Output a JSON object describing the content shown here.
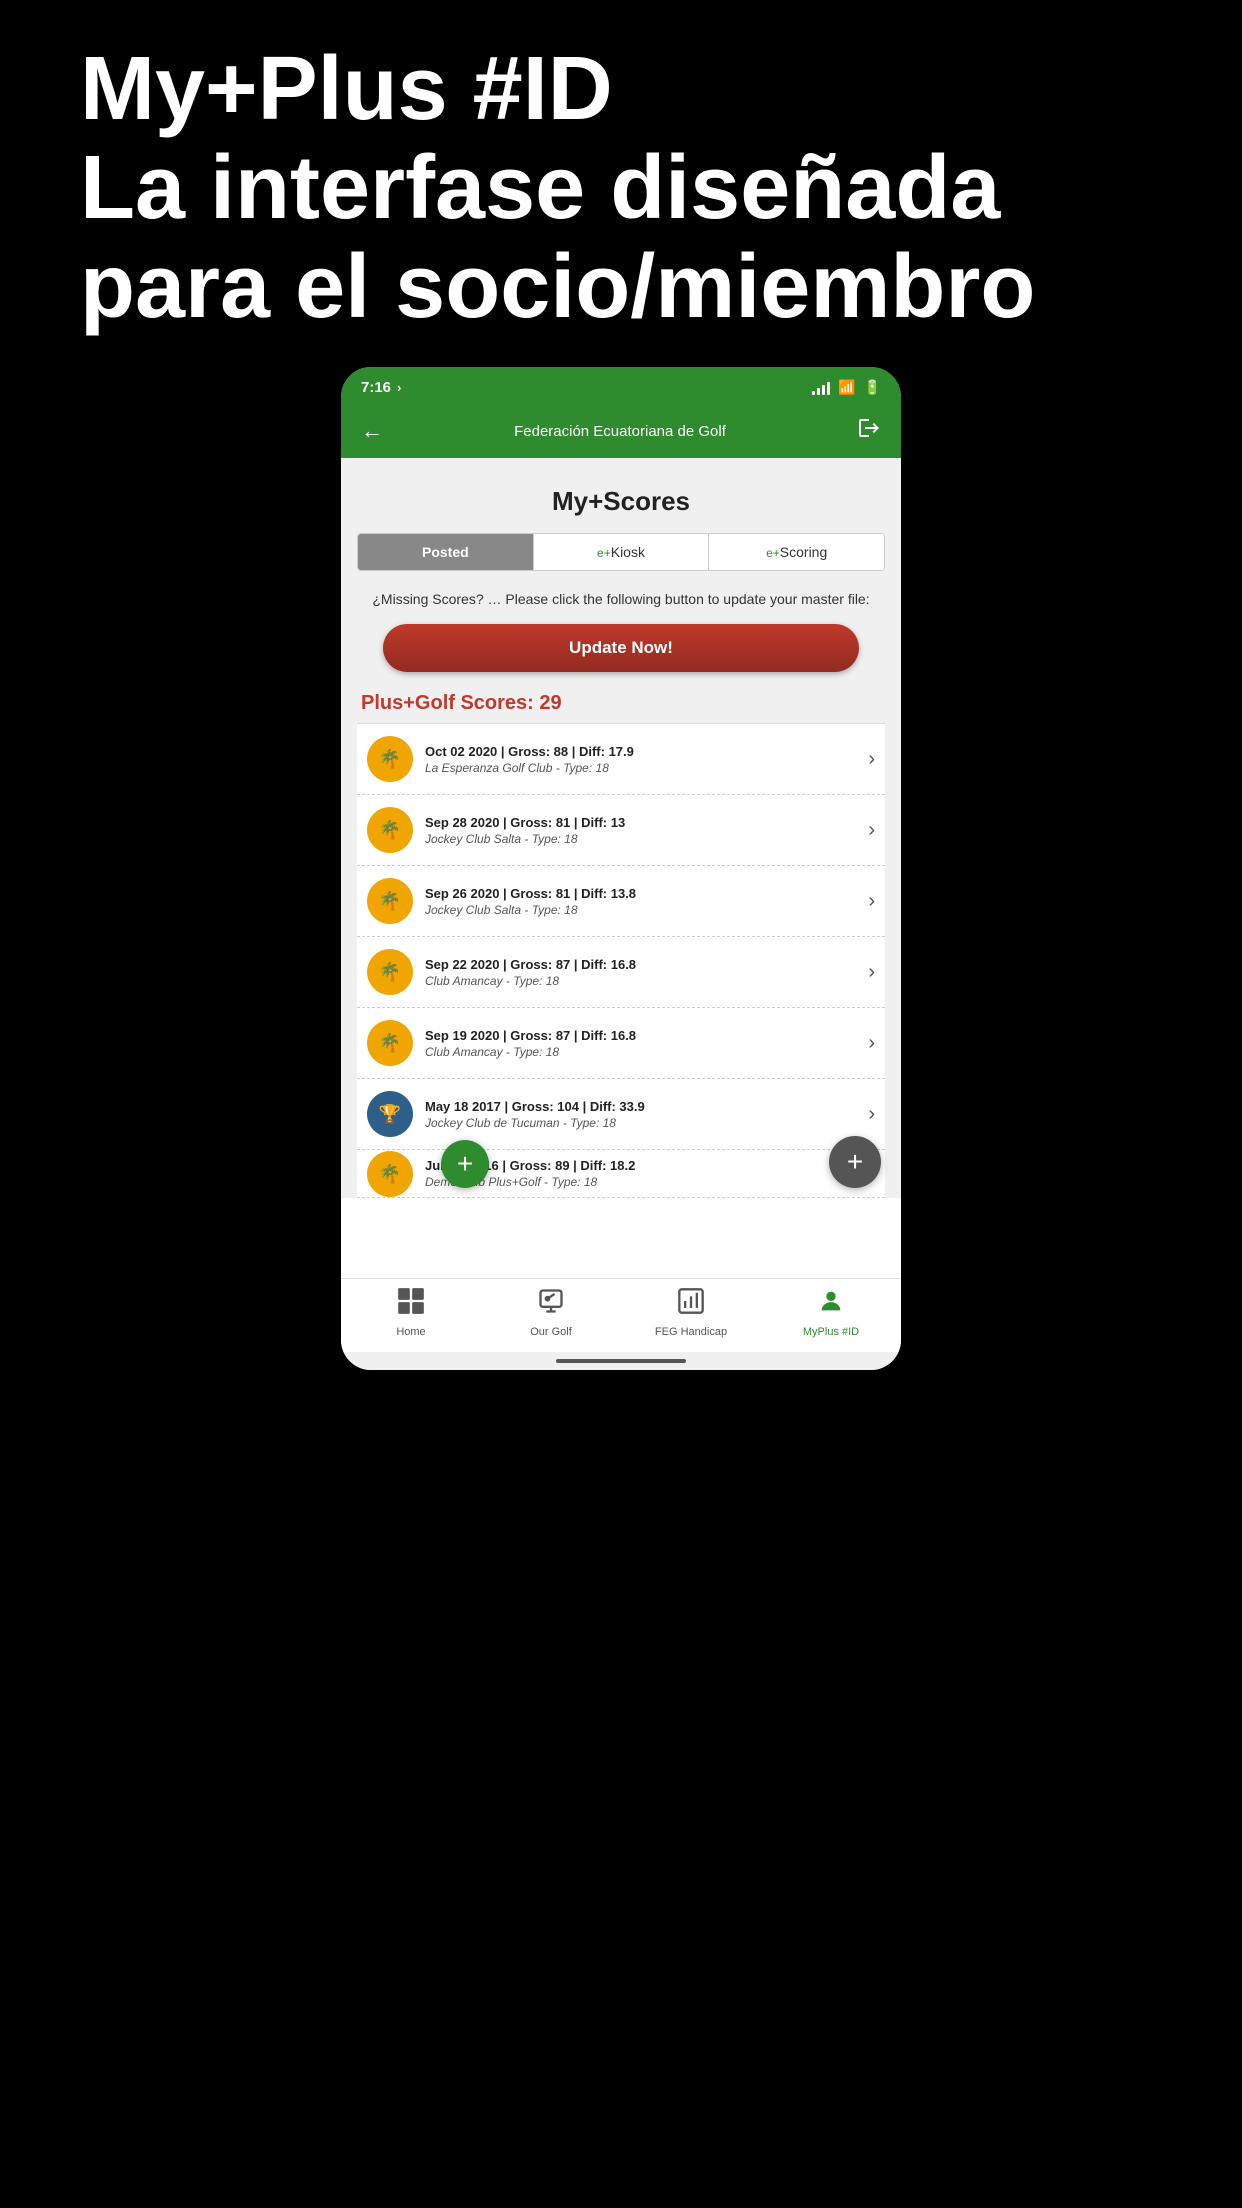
{
  "outer": {
    "title_line1": "My+Plus #ID",
    "title_line2": "La interfase diseñada",
    "title_line3": "para el socio/miembro"
  },
  "status_bar": {
    "time": "7:16",
    "location_icon": "›"
  },
  "nav_bar": {
    "title": "Federación Ecuatoriana de Golf",
    "back_label": "←",
    "logout_label": "⎋"
  },
  "page": {
    "title": "My+Scores"
  },
  "tabs": [
    {
      "label": "Posted",
      "active": true,
      "prefix": ""
    },
    {
      "label": "Kiosk",
      "active": false,
      "prefix": "e+"
    },
    {
      "label": "Scoring",
      "active": false,
      "prefix": "e+"
    }
  ],
  "missing_note": "¿Missing Scores? … Please click the following button to update your master file:",
  "update_button": "Update Now!",
  "scores_heading": "Plus+Golf Scores: 29",
  "scores": [
    {
      "date_gross_diff": "Oct 02 2020 | Gross: 88 | Diff: 17.9",
      "club_type": "La Esperanza Golf Club - Type: 18",
      "icon_type": "palm"
    },
    {
      "date_gross_diff": "Sep 28 2020 | Gross: 81 | Diff: 13",
      "club_type": "Jockey Club Salta - Type: 18",
      "icon_type": "palm"
    },
    {
      "date_gross_diff": "Sep 26 2020 | Gross: 81 | Diff: 13.8",
      "club_type": "Jockey Club Salta - Type: 18",
      "icon_type": "palm"
    },
    {
      "date_gross_diff": "Sep 22 2020 | Gross: 87 | Diff: 16.8",
      "club_type": "Club Amancay - Type: 18",
      "icon_type": "palm"
    },
    {
      "date_gross_diff": "Sep 19 2020 | Gross: 87 | Diff: 16.8",
      "club_type": "Club Amancay - Type: 18",
      "icon_type": "palm"
    },
    {
      "date_gross_diff": "May 18 2017 | Gross: 104 | Diff: 33.9",
      "club_type": "Jockey Club de Tucuman - Type: 18",
      "icon_type": "trophy"
    },
    {
      "date_gross_diff": "Jun 08 2016 | Gross: 89 | Diff: 18.2",
      "club_type": "Demo Club Plus+Golf - Type: 18",
      "icon_type": "palm"
    }
  ],
  "bottom_nav": [
    {
      "label": "Home",
      "active": false,
      "icon": "🏠"
    },
    {
      "label": "Our Golf",
      "active": false,
      "icon": "🔍"
    },
    {
      "label": "FEG Handicap",
      "active": false,
      "icon": "📊"
    },
    {
      "label": "MyPlus #ID",
      "active": true,
      "icon": "👤"
    }
  ],
  "fab_green_label": "+",
  "fab_dark_label": "+"
}
